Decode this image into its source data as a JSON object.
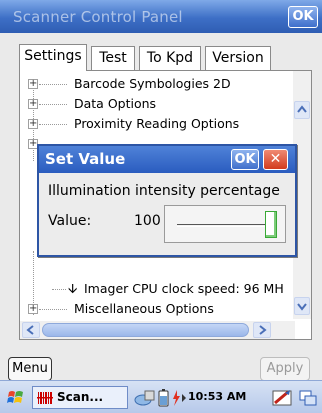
{
  "window": {
    "title": "Scanner Control Panel",
    "ok_label": "OK"
  },
  "tabs": [
    {
      "label": "Settings",
      "active": true
    },
    {
      "label": "Test"
    },
    {
      "label": "To Kpd"
    },
    {
      "label": "Version"
    }
  ],
  "tree": {
    "items": [
      {
        "label": "Barcode Symbologies 2D",
        "expander": "+"
      },
      {
        "label": "Data Options",
        "expander": "+"
      },
      {
        "label": "Proximity Reading Options",
        "expander": "+"
      },
      {
        "label": "Imager CPU clock speed: 96 MH",
        "expander": ""
      },
      {
        "label": "Miscellaneous Options",
        "expander": "+"
      }
    ]
  },
  "dialog": {
    "title": "Set Value",
    "ok_label": "OK",
    "close_label": "✕",
    "prompt": "Illumination intensity percentage",
    "value_label": "Value:",
    "value": "100",
    "slider_level": 1.0
  },
  "buttons": {
    "menu": "Menu",
    "apply": "Apply"
  },
  "taskbar": {
    "app_label": "Scan...",
    "clock": "10:53 AM"
  },
  "colors": {
    "title_blue": "#2f5db3",
    "dialog_border": "#2d55a5",
    "close_red": "#d23b1e",
    "slider_knob_green": "#39a836"
  },
  "icons": [
    "windows-flag-icon",
    "scanner-app-icon",
    "network-icon",
    "battery-icon",
    "keyboard-icon",
    "taskbar-switch-icon"
  ]
}
